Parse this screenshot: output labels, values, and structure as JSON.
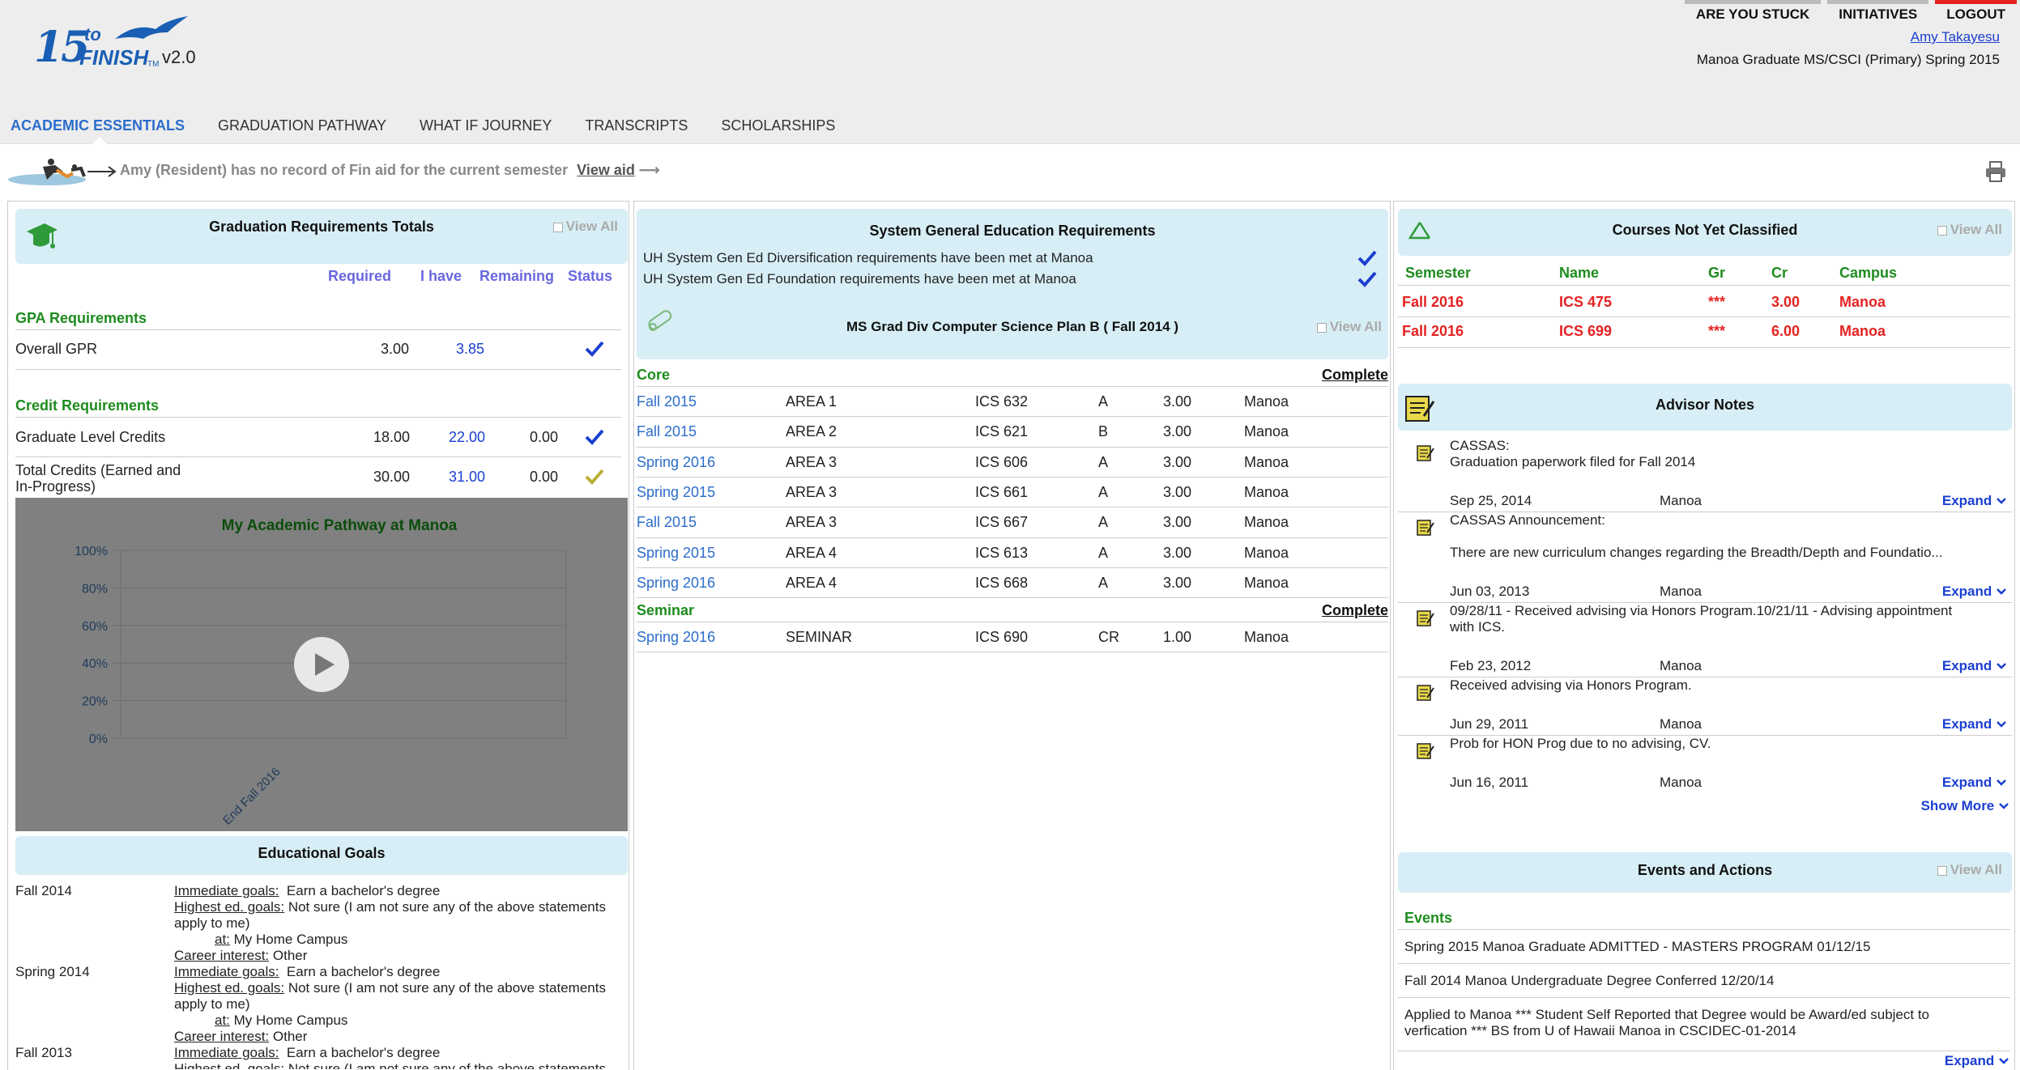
{
  "header": {
    "logo_15": "15",
    "logo_to": "to",
    "logo_finish": "FINISH",
    "logo_tm": "TM",
    "version": "v2.0",
    "topnav": [
      "ARE YOU STUCK",
      "INITIATIVES",
      "LOGOUT"
    ],
    "user_name": "Amy Takayesu",
    "program": "Manoa Graduate MS/CSCI (Primary) Spring 2015"
  },
  "tabs": [
    "ACADEMIC ESSENTIALS",
    "GRADUATION PATHWAY",
    "WHAT IF JOURNEY",
    "TRANSCRIPTS",
    "SCHOLARSHIPS"
  ],
  "finaid": {
    "message": "Amy (Resident) has no record of Fin aid for the current semester",
    "link": "View aid",
    "arrow": "⟶"
  },
  "grad_totals": {
    "title": "Graduation Requirements Totals",
    "view_all": "View All",
    "columns": [
      "Required",
      "I have",
      "Remaining",
      "Status"
    ],
    "gpa_header": "GPA Requirements",
    "gpa_rows": [
      {
        "label": "Overall GPR",
        "required": "3.00",
        "have": "3.85",
        "remaining": "",
        "status": "blue-check"
      }
    ],
    "credit_header": "Credit Requirements",
    "credit_rows": [
      {
        "label": "Graduate Level Credits",
        "required": "18.00",
        "have": "22.00",
        "remaining": "0.00",
        "status": "blue-check"
      },
      {
        "label": "Total Credits (Earned and In-Progress)",
        "required": "30.00",
        "have": "31.00",
        "remaining": "0.00",
        "status": "olive-check"
      }
    ]
  },
  "chart_data": {
    "type": "bar",
    "title": "My Academic Pathway at Manoa",
    "categories": [
      "End Fall 2016"
    ],
    "values": [],
    "yticks": [
      "100%",
      "80%",
      "60%",
      "40%",
      "20%",
      "0%"
    ],
    "ylim": [
      0,
      100
    ],
    "grid": true
  },
  "edu_goals": {
    "title": "Educational Goals",
    "entries": [
      {
        "term": "Fall 2014",
        "immediate_label": "Immediate goals:",
        "immediate": "Earn a bachelor's degree",
        "highest_label": "Highest ed. goals:",
        "highest": "Not sure (I am not sure any of the above statements apply to me)",
        "at_label": "at:",
        "at": "My Home Campus",
        "career_label": "Career interest:",
        "career": "Other"
      },
      {
        "term": "Spring 2014",
        "immediate_label": "Immediate goals:",
        "immediate": "Earn a bachelor's degree",
        "highest_label": "Highest ed. goals:",
        "highest": "Not sure (I am not sure any of the above statements apply to me)",
        "at_label": "at:",
        "at": "My Home Campus",
        "career_label": "Career interest:",
        "career": "Other"
      },
      {
        "term": "Fall 2013",
        "immediate_label": "Immediate goals:",
        "immediate": "Earn a bachelor's degree",
        "highest_label": "Highest ed. goals:",
        "highest": "Not sure (I am not sure any of the above statements apply to me)"
      }
    ]
  },
  "gen_ed": {
    "title": "System General Education Requirements",
    "items": [
      "UH System Gen Ed Diversification requirements have been met at Manoa",
      "UH System Gen Ed Foundation requirements have been met at Manoa"
    ]
  },
  "plan": {
    "title": "MS Grad Div Computer Science Plan B ( Fall 2014 )",
    "view_all": "View All",
    "sections": [
      {
        "name": "Core",
        "status": "Complete",
        "rows": [
          {
            "term": "Fall 2015",
            "area": "AREA 1",
            "course": "ICS 632",
            "grade": "A",
            "credits": "3.00",
            "campus": "Manoa"
          },
          {
            "term": "Fall 2015",
            "area": "AREA 2",
            "course": "ICS 621",
            "grade": "B",
            "credits": "3.00",
            "campus": "Manoa"
          },
          {
            "term": "Spring 2016",
            "area": "AREA 3",
            "course": "ICS 606",
            "grade": "A",
            "credits": "3.00",
            "campus": "Manoa"
          },
          {
            "term": "Spring 2015",
            "area": "AREA 3",
            "course": "ICS 661",
            "grade": "A",
            "credits": "3.00",
            "campus": "Manoa"
          },
          {
            "term": "Fall 2015",
            "area": "AREA 3",
            "course": "ICS 667",
            "grade": "A",
            "credits": "3.00",
            "campus": "Manoa"
          },
          {
            "term": "Spring 2015",
            "area": "AREA 4",
            "course": "ICS 613",
            "grade": "A",
            "credits": "3.00",
            "campus": "Manoa"
          },
          {
            "term": "Spring 2016",
            "area": "AREA 4",
            "course": "ICS 668",
            "grade": "A",
            "credits": "3.00",
            "campus": "Manoa"
          }
        ]
      },
      {
        "name": "Seminar",
        "status": "Complete",
        "rows": [
          {
            "term": "Spring 2016",
            "area": "SEMINAR",
            "course": "ICS 690",
            "grade": "CR",
            "credits": "1.00",
            "campus": "Manoa"
          }
        ]
      }
    ]
  },
  "unclassified": {
    "title": "Courses Not Yet Classified",
    "view_all": "View All",
    "columns": [
      "Semester",
      "Name",
      "Gr",
      "Cr",
      "Campus"
    ],
    "rows": [
      {
        "semester": "Fall 2016",
        "name": "ICS 475",
        "gr": "***",
        "cr": "3.00",
        "campus": "Manoa"
      },
      {
        "semester": "Fall 2016",
        "name": "ICS 699",
        "gr": "***",
        "cr": "6.00",
        "campus": "Manoa"
      }
    ]
  },
  "advisor_notes": {
    "title": "Advisor Notes",
    "expand": "Expand",
    "show_more": "Show More",
    "notes": [
      {
        "line1": "CASSAS:",
        "line2": "Graduation paperwork filed for Fall 2014",
        "date": "Sep 25, 2014",
        "campus": "Manoa"
      },
      {
        "line1": "CASSAS Announcement:",
        "line2": "There are new curriculum changes regarding the Breadth/Depth and Foundatio...",
        "date": "Jun 03, 2013",
        "campus": "Manoa"
      },
      {
        "line1": "09/28/11 - Received advising via Honors Program.10/21/11 - Advising appointment",
        "line2": "with ICS.",
        "date": "Feb 23, 2012",
        "campus": "Manoa"
      },
      {
        "line1": "Received advising via Honors Program.",
        "line2": "",
        "date": "Jun 29, 2011",
        "campus": "Manoa"
      },
      {
        "line1": "Prob for HON Prog due to no advising, CV.",
        "line2": "",
        "date": "Jun 16, 2011",
        "campus": "Manoa"
      }
    ]
  },
  "events": {
    "title": "Events and Actions",
    "view_all": "View All",
    "header": "Events",
    "expand": "Expand",
    "items": [
      "Spring 2015 Manoa Graduate ADMITTED - MASTERS PROGRAM 01/12/15",
      "Fall 2014 Manoa Undergraduate Degree Conferred 12/20/14",
      "Applied to Manoa *** Student Self Reported that Degree would be Award/ed subject to",
      "verfication *** BS from U of Hawaii Manoa in CSCIDEC-01-2014"
    ]
  },
  "colors": {
    "accent": "#2b6dcc",
    "box_bg": "#d7eef6",
    "green": "#1e8c1e",
    "red": "#e52222",
    "check_blue": "#1b3fd1",
    "check_olive": "#b8b030"
  }
}
